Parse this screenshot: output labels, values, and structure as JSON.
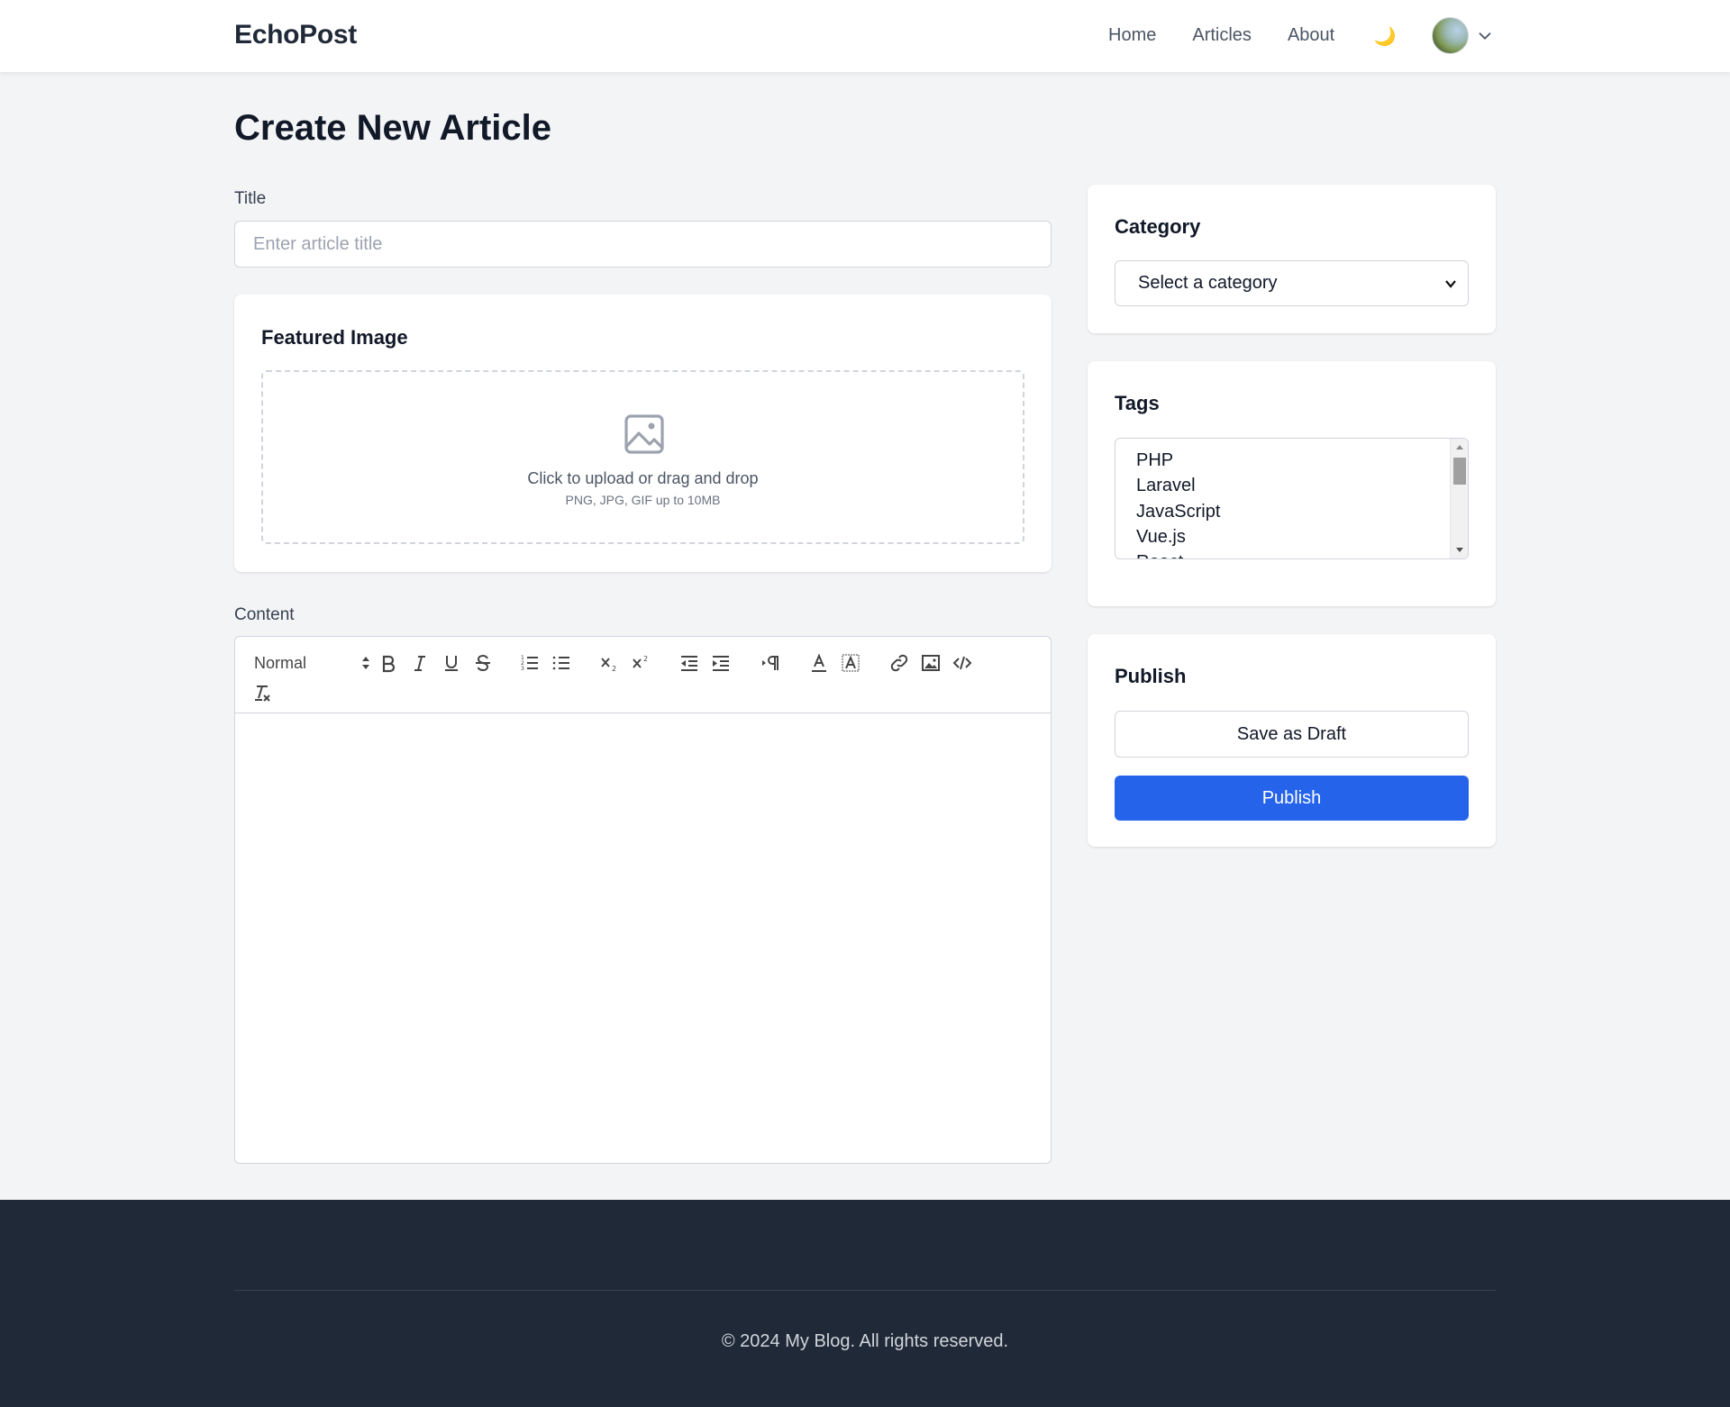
{
  "brand": "EchoPost",
  "nav": {
    "links": [
      "Home",
      "Articles",
      "About"
    ],
    "theme_icon": "moon-icon",
    "theme_glyph": "🌙"
  },
  "page": {
    "title": "Create New Article"
  },
  "form": {
    "title_label": "Title",
    "title_placeholder": "Enter article title",
    "title_value": "",
    "featured_image": {
      "heading": "Featured Image",
      "upload_text": "Click to upload or drag and drop",
      "upload_hint": "PNG, JPG, GIF up to 10MB"
    },
    "content_label": "Content",
    "editor": {
      "header_select": "Normal",
      "toolbar_buttons": [
        "bold",
        "italic",
        "underline",
        "strike",
        "ordered-list",
        "bullet-list",
        "subscript",
        "superscript",
        "outdent",
        "indent",
        "text-direction",
        "text-color",
        "background-color",
        "link",
        "image",
        "code-block",
        "clean-format"
      ],
      "content": ""
    }
  },
  "sidebar": {
    "category": {
      "heading": "Category",
      "selected": "Select a category"
    },
    "tags": {
      "heading": "Tags",
      "items": [
        "PHP",
        "Laravel",
        "JavaScript",
        "Vue.js",
        "React"
      ]
    },
    "publish": {
      "heading": "Publish",
      "draft_label": "Save as Draft",
      "publish_label": "Publish",
      "publish_color": "#2563eb"
    }
  },
  "footer": {
    "copyright": "© 2024 My Blog. All rights reserved."
  },
  "colors": {
    "page_bg": "#f3f4f6",
    "footer_bg": "#1f2937",
    "accent": "#2563eb"
  }
}
